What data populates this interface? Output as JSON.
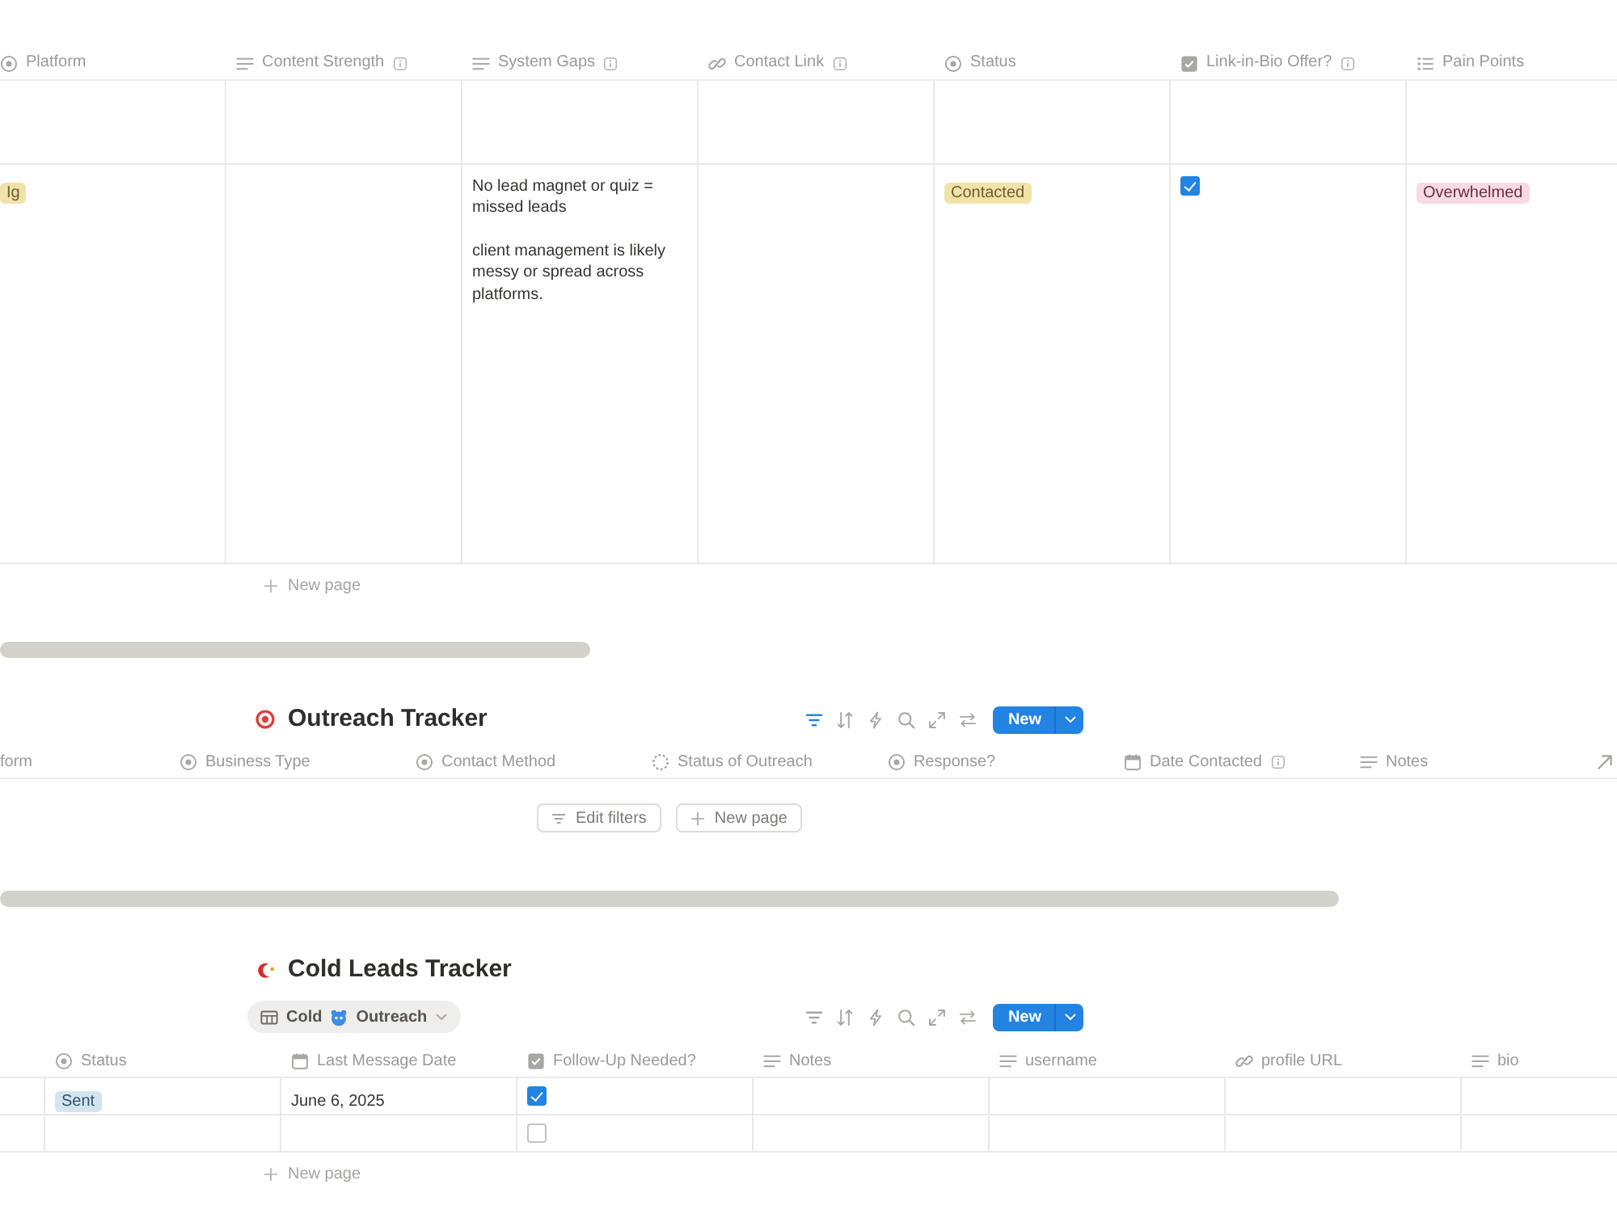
{
  "databases": [
    {
      "columns": [
        {
          "name": "Platform",
          "kind": "select"
        },
        {
          "name": "Content Strength",
          "kind": "text",
          "has_description": true
        },
        {
          "name": "System Gaps",
          "kind": "text",
          "has_description": true
        },
        {
          "name": "Contact Link",
          "kind": "link",
          "has_description": true
        },
        {
          "name": "Status",
          "kind": "select"
        },
        {
          "name": "Link-in-Bio Offer?",
          "kind": "checkbox",
          "has_description": true
        },
        {
          "name": "Pain Points",
          "kind": "multi_select"
        }
      ],
      "rows": [
        {
          "cells": [
            null,
            null,
            null,
            null,
            null,
            null,
            null
          ]
        },
        {
          "cells": [
            {
              "tag": "Ig",
              "color": "#f1e2a8"
            },
            null,
            {
              "paragraphs": [
                "No lead magnet or quiz = missed leads",
                "client management is likely messy or spread across platforms."
              ]
            },
            null,
            {
              "tag": "Contacted",
              "color": "#f1e2a8"
            },
            {
              "checked": true
            },
            {
              "tag": "Overwhelmed",
              "color": "#f8d9e4"
            }
          ]
        }
      ],
      "add_row": {
        "label": "New page"
      },
      "h_scrollbar": true
    },
    {
      "title": "Outreach Tracker",
      "toolbar": {
        "filter_active": true,
        "new_label": "New"
      },
      "columns": [
        {
          "name": "form"
        },
        {
          "name": "Business Type",
          "kind": "select"
        },
        {
          "name": "Contact Method",
          "kind": "select"
        },
        {
          "name": "Status of Outreach",
          "kind": "status"
        },
        {
          "name": "Response?",
          "kind": "select"
        },
        {
          "name": "Date Contacted",
          "kind": "date",
          "has_description": true
        },
        {
          "name": "Notes",
          "kind": "text"
        },
        {
          "kind": "relation"
        }
      ],
      "empty_state": {
        "buttons": [
          {
            "label": "Edit filters",
            "kind": "filter"
          },
          {
            "label": "New page",
            "kind": "add"
          }
        ]
      },
      "h_scrollbar": true
    },
    {
      "title": "Cold Leads Tracker",
      "view_tabs": [
        {
          "label_parts": [
            "Cold",
            "Outreach"
          ],
          "selected": true
        }
      ],
      "toolbar": {
        "filter_active": false,
        "new_label": "New"
      },
      "columns": [
        {
          "name": "Status",
          "kind": "select"
        },
        {
          "name": "Last Message Date",
          "kind": "date"
        },
        {
          "name": "Follow-Up Needed?",
          "kind": "checkbox"
        },
        {
          "name": "Notes",
          "kind": "text"
        },
        {
          "name": "username",
          "kind": "text"
        },
        {
          "name": "profile URL",
          "kind": "link"
        },
        {
          "name": "bio",
          "kind": "text"
        }
      ],
      "rows": [
        {
          "cells": [
            {
              "tag": "Sent",
              "color": "#d3e5ef"
            },
            {
              "text": "June 6, 2025"
            },
            {
              "checked": true
            },
            null,
            null,
            null,
            null
          ]
        },
        {
          "cells": [
            null,
            null,
            {
              "checked": false
            },
            null,
            null,
            null,
            null
          ]
        }
      ],
      "add_row": {
        "label": "New page"
      }
    }
  ]
}
